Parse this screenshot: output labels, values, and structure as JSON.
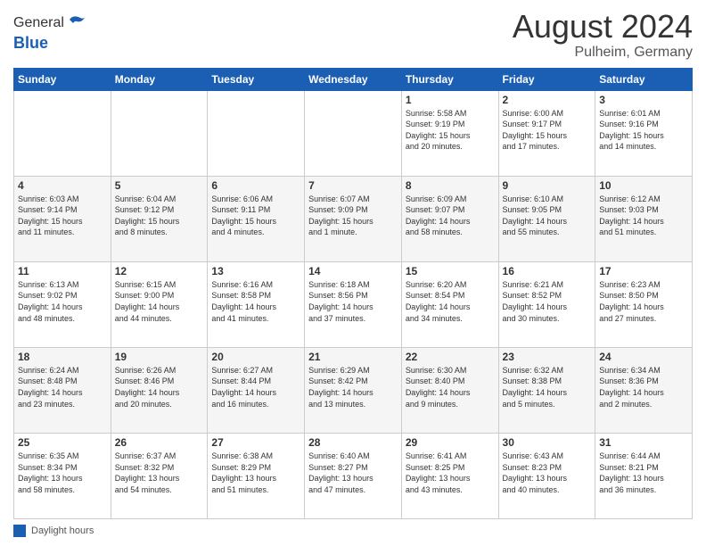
{
  "logo": {
    "line1": "General",
    "line2": "Blue"
  },
  "header": {
    "title": "August 2024",
    "subtitle": "Pulheim, Germany"
  },
  "columns": [
    "Sunday",
    "Monday",
    "Tuesday",
    "Wednesday",
    "Thursday",
    "Friday",
    "Saturday"
  ],
  "weeks": [
    [
      {
        "day": "",
        "info": ""
      },
      {
        "day": "",
        "info": ""
      },
      {
        "day": "",
        "info": ""
      },
      {
        "day": "",
        "info": ""
      },
      {
        "day": "1",
        "info": "Sunrise: 5:58 AM\nSunset: 9:19 PM\nDaylight: 15 hours\nand 20 minutes."
      },
      {
        "day": "2",
        "info": "Sunrise: 6:00 AM\nSunset: 9:17 PM\nDaylight: 15 hours\nand 17 minutes."
      },
      {
        "day": "3",
        "info": "Sunrise: 6:01 AM\nSunset: 9:16 PM\nDaylight: 15 hours\nand 14 minutes."
      }
    ],
    [
      {
        "day": "4",
        "info": "Sunrise: 6:03 AM\nSunset: 9:14 PM\nDaylight: 15 hours\nand 11 minutes."
      },
      {
        "day": "5",
        "info": "Sunrise: 6:04 AM\nSunset: 9:12 PM\nDaylight: 15 hours\nand 8 minutes."
      },
      {
        "day": "6",
        "info": "Sunrise: 6:06 AM\nSunset: 9:11 PM\nDaylight: 15 hours\nand 4 minutes."
      },
      {
        "day": "7",
        "info": "Sunrise: 6:07 AM\nSunset: 9:09 PM\nDaylight: 15 hours\nand 1 minute."
      },
      {
        "day": "8",
        "info": "Sunrise: 6:09 AM\nSunset: 9:07 PM\nDaylight: 14 hours\nand 58 minutes."
      },
      {
        "day": "9",
        "info": "Sunrise: 6:10 AM\nSunset: 9:05 PM\nDaylight: 14 hours\nand 55 minutes."
      },
      {
        "day": "10",
        "info": "Sunrise: 6:12 AM\nSunset: 9:03 PM\nDaylight: 14 hours\nand 51 minutes."
      }
    ],
    [
      {
        "day": "11",
        "info": "Sunrise: 6:13 AM\nSunset: 9:02 PM\nDaylight: 14 hours\nand 48 minutes."
      },
      {
        "day": "12",
        "info": "Sunrise: 6:15 AM\nSunset: 9:00 PM\nDaylight: 14 hours\nand 44 minutes."
      },
      {
        "day": "13",
        "info": "Sunrise: 6:16 AM\nSunset: 8:58 PM\nDaylight: 14 hours\nand 41 minutes."
      },
      {
        "day": "14",
        "info": "Sunrise: 6:18 AM\nSunset: 8:56 PM\nDaylight: 14 hours\nand 37 minutes."
      },
      {
        "day": "15",
        "info": "Sunrise: 6:20 AM\nSunset: 8:54 PM\nDaylight: 14 hours\nand 34 minutes."
      },
      {
        "day": "16",
        "info": "Sunrise: 6:21 AM\nSunset: 8:52 PM\nDaylight: 14 hours\nand 30 minutes."
      },
      {
        "day": "17",
        "info": "Sunrise: 6:23 AM\nSunset: 8:50 PM\nDaylight: 14 hours\nand 27 minutes."
      }
    ],
    [
      {
        "day": "18",
        "info": "Sunrise: 6:24 AM\nSunset: 8:48 PM\nDaylight: 14 hours\nand 23 minutes."
      },
      {
        "day": "19",
        "info": "Sunrise: 6:26 AM\nSunset: 8:46 PM\nDaylight: 14 hours\nand 20 minutes."
      },
      {
        "day": "20",
        "info": "Sunrise: 6:27 AM\nSunset: 8:44 PM\nDaylight: 14 hours\nand 16 minutes."
      },
      {
        "day": "21",
        "info": "Sunrise: 6:29 AM\nSunset: 8:42 PM\nDaylight: 14 hours\nand 13 minutes."
      },
      {
        "day": "22",
        "info": "Sunrise: 6:30 AM\nSunset: 8:40 PM\nDaylight: 14 hours\nand 9 minutes."
      },
      {
        "day": "23",
        "info": "Sunrise: 6:32 AM\nSunset: 8:38 PM\nDaylight: 14 hours\nand 5 minutes."
      },
      {
        "day": "24",
        "info": "Sunrise: 6:34 AM\nSunset: 8:36 PM\nDaylight: 14 hours\nand 2 minutes."
      }
    ],
    [
      {
        "day": "25",
        "info": "Sunrise: 6:35 AM\nSunset: 8:34 PM\nDaylight: 13 hours\nand 58 minutes."
      },
      {
        "day": "26",
        "info": "Sunrise: 6:37 AM\nSunset: 8:32 PM\nDaylight: 13 hours\nand 54 minutes."
      },
      {
        "day": "27",
        "info": "Sunrise: 6:38 AM\nSunset: 8:29 PM\nDaylight: 13 hours\nand 51 minutes."
      },
      {
        "day": "28",
        "info": "Sunrise: 6:40 AM\nSunset: 8:27 PM\nDaylight: 13 hours\nand 47 minutes."
      },
      {
        "day": "29",
        "info": "Sunrise: 6:41 AM\nSunset: 8:25 PM\nDaylight: 13 hours\nand 43 minutes."
      },
      {
        "day": "30",
        "info": "Sunrise: 6:43 AM\nSunset: 8:23 PM\nDaylight: 13 hours\nand 40 minutes."
      },
      {
        "day": "31",
        "info": "Sunrise: 6:44 AM\nSunset: 8:21 PM\nDaylight: 13 hours\nand 36 minutes."
      }
    ]
  ],
  "footer": {
    "label": "Daylight hours"
  }
}
